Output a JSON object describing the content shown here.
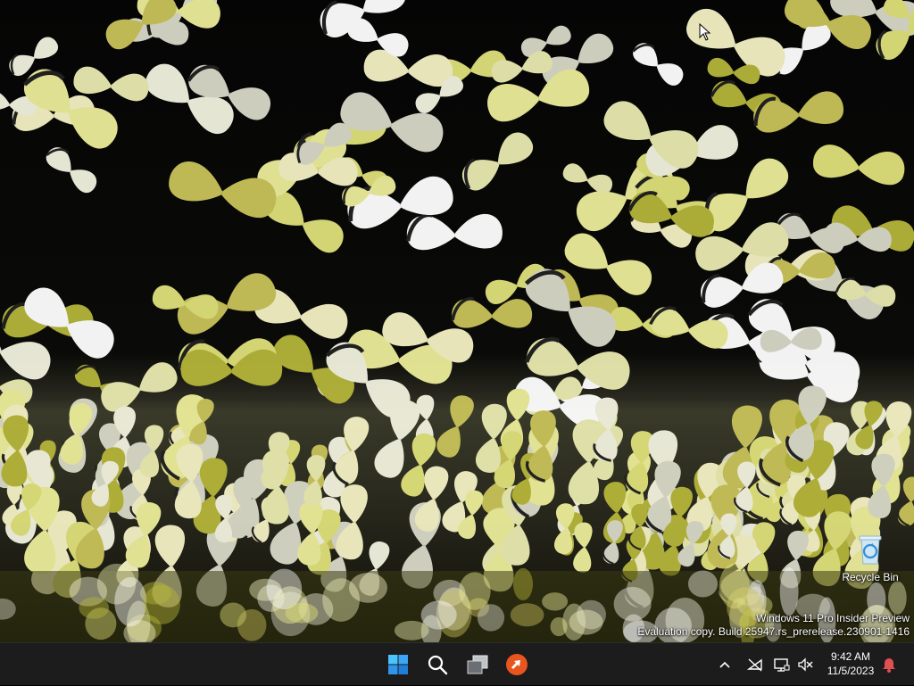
{
  "desktop": {
    "wallpaper": "butterflies-wallpaper",
    "icons": [
      {
        "label": "Recycle Bin",
        "icon": "recycle-bin-icon"
      }
    ],
    "watermark": {
      "line1": "Windows 11 Pro Insider Preview",
      "line2": "Evaluation copy. Build 25947.rs_prerelease.230901-1416"
    }
  },
  "taskbar": {
    "apps": [
      {
        "name": "Start",
        "icon": "windows-start-icon"
      },
      {
        "name": "Search",
        "icon": "search-icon"
      },
      {
        "name": "Task View",
        "icon": "task-view-icon"
      },
      {
        "name": "Remote Desktop",
        "icon": "remote-desktop-icon"
      }
    ],
    "tray": {
      "icons": [
        "chevron-up-icon",
        "network-off-icon",
        "display-icon",
        "volume-muted-icon",
        "notification-bell-icon"
      ],
      "time": "9:42 AM",
      "date": "11/5/2023"
    }
  },
  "colors": {
    "taskbar_bg": "#1c1c1c",
    "start_blue": "#3a9bf0",
    "remote_orange": "#e8551f",
    "bell_red": "#e05050"
  }
}
